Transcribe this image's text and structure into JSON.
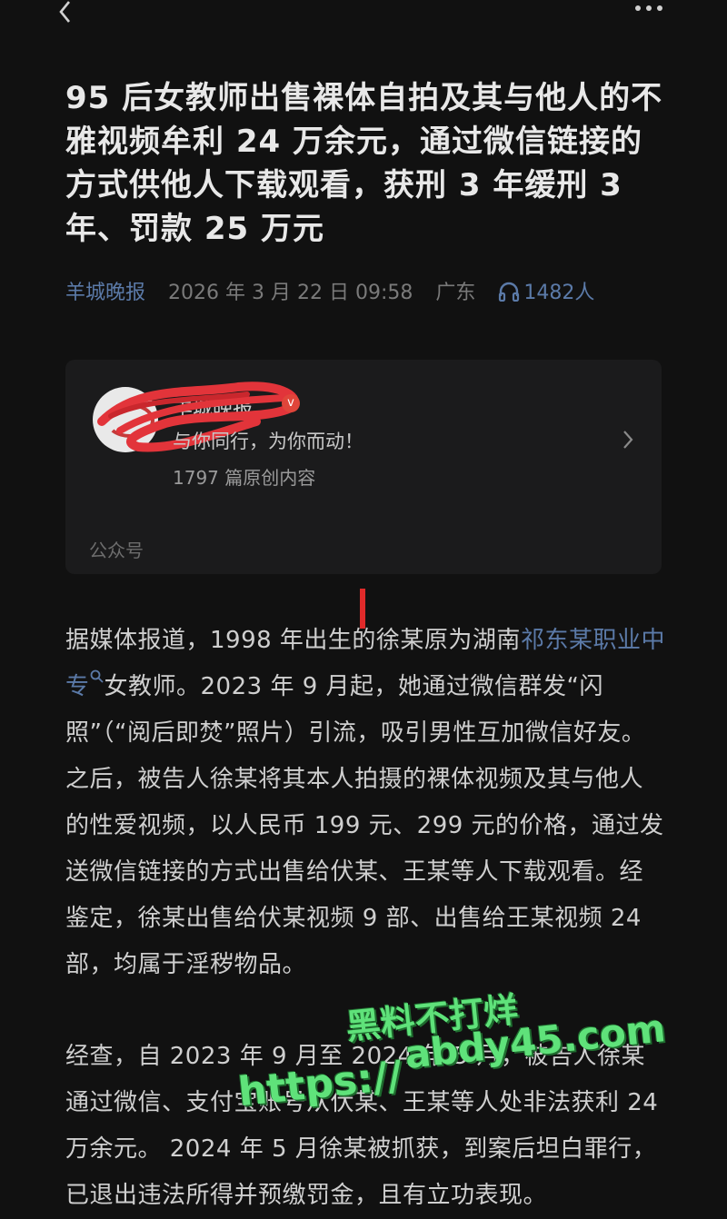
{
  "nav": {
    "back_icon": "chevron-left-icon",
    "more_icon": "more-dots-icon"
  },
  "article": {
    "title": "95 后女教师出售裸体自拍及其与他人的不雅视频牟利 24 万余元，通过微信链接的方式供他人下载观看，获刑 3 年缓刑 3 年、罚款 25 万元",
    "source": "羊城晚报",
    "date": "2026 年 3 月 22 日 09:58",
    "region": "广东",
    "listeners": "1482人"
  },
  "account_card": {
    "name": "羊城晚报",
    "slogan": "与你同行，为你而动！",
    "count": "1797 篇原创内容",
    "type": "公众号",
    "verified_mark": "v"
  },
  "body": {
    "p1_a": "据媒体报道，1998 年出生的徐某原为湖南",
    "p1_link": "祁东某职业中专",
    "p1_b": "女教师。2023 年 9 月起，她通过微信群发“闪照”（“阅后即焚”照片）引流，吸引男性互加微信好友。之后，被告人徐某将其本人拍摄的裸体视频及其与他人的性爱视频，以人民币 199 元、299 元的价格，通过发送微信链接的方式出售给伏某、王某等人下载观看。经鉴定，徐某出售给伏某视频 9 部、出售给王某视频 24 部，均属于淫秽物品。",
    "p2": "经查，自 2023 年 9 月至 2024 年 5 月，被告人徐某通过微信、支付宝账号从伏某、王某等人处非法获利 24 万余元。 2024 年 5 月徐某被抓获，到案后坦白罪行，已退出违法所得并预缴罚金，且有立功表现。"
  },
  "watermark": {
    "line1": "黑料不打烊",
    "line2": "abdy45.com",
    "line3": "https://"
  },
  "colors": {
    "background": "#111111",
    "link": "#5b7aa8",
    "watermark": "#5fe27a",
    "badge": "#e0453a"
  }
}
